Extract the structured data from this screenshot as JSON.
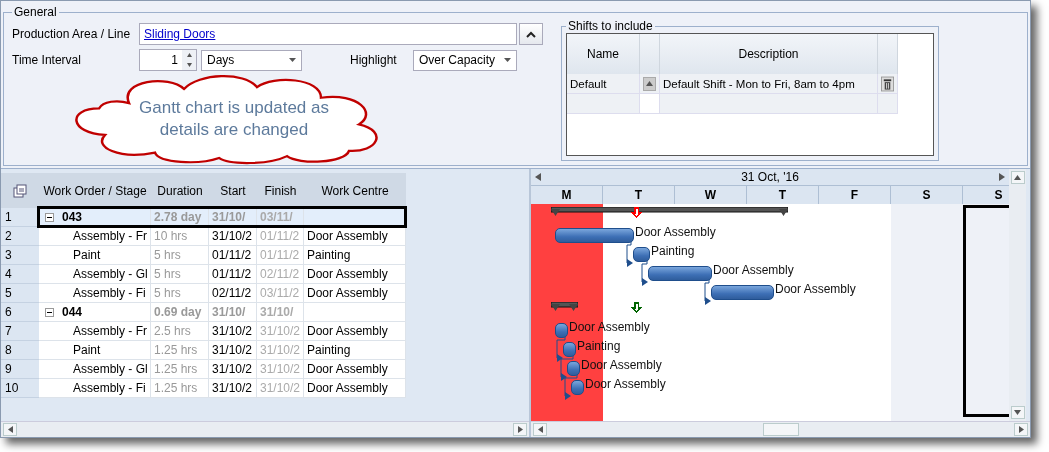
{
  "general": {
    "title": "General",
    "production_area": {
      "label": "Production Area / Line",
      "value": "Sliding Doors"
    },
    "time_interval": {
      "label": "Time Interval",
      "value": "1",
      "unit": "Days"
    },
    "highlight": {
      "label": "Highlight",
      "value": "Over Capacity"
    }
  },
  "shifts": {
    "title": "Shifts to include",
    "columns": [
      "Name",
      "Description"
    ],
    "rows": [
      {
        "name": "Default",
        "description": "Default Shift - Mon to Fri, 8am to 4pm"
      }
    ]
  },
  "callout": {
    "text": "Gantt chart is updated as details are changed"
  },
  "grid": {
    "columns": [
      "Work Order / Stage",
      "Duration",
      "Start",
      "Finish",
      "Work Centre"
    ],
    "rows": [
      {
        "number": "1",
        "name": "043",
        "duration": "2.78 day",
        "start": "31/10/",
        "finish": "03/11/",
        "expanded": true,
        "selected": true,
        "children": [
          {
            "number": "2",
            "name": "Assembly - Fr",
            "duration": "10 hrs",
            "start": "31/10/2",
            "finish": "01/11/2",
            "work_centre": "Door Assembly",
            "selected": false
          },
          {
            "number": "3",
            "name": "Paint",
            "duration": "5 hrs",
            "start": "01/11/2",
            "finish": "01/11/2",
            "work_centre": "Painting",
            "selected": false
          },
          {
            "number": "4",
            "name": "Assembly - Gl",
            "duration": "5 hrs",
            "start": "01/11/2",
            "finish": "02/11/2",
            "work_centre": "Door Assembly",
            "selected": false
          },
          {
            "number": "5",
            "name": "Assembly - Fi",
            "duration": "5 hrs",
            "start": "02/11/2",
            "finish": "03/11/2",
            "work_centre": "Door Assembly",
            "selected": false
          }
        ]
      },
      {
        "number": "6",
        "name": "044",
        "duration": "0.69 day",
        "start": "31/10/",
        "finish": "31/10/",
        "expanded": true,
        "selected": false,
        "children": [
          {
            "number": "7",
            "name": "Assembly - Fr",
            "duration": "2.5 hrs",
            "start": "31/10/2",
            "finish": "31/10/2",
            "work_centre": "Door Assembly",
            "selected": false
          },
          {
            "number": "8",
            "name": "Paint",
            "duration": "1.25 hrs",
            "start": "31/10/2",
            "finish": "31/10/2",
            "work_centre": "Painting",
            "selected": false
          },
          {
            "number": "9",
            "name": "Assembly - Gl",
            "duration": "1.25 hrs",
            "start": "31/10/2",
            "finish": "31/10/2",
            "work_centre": "Door Assembly",
            "selected": false
          },
          {
            "number": "10",
            "name": "Assembly - Fi",
            "duration": "1.25 hrs",
            "start": "31/10/2",
            "finish": "31/10/2",
            "work_centre": "Door Assembly",
            "selected": false
          }
        ]
      }
    ]
  },
  "gantt": {
    "date": "31 Oct, '16",
    "days": [
      {
        "label": "M",
        "over_capacity": true,
        "weekend": false
      },
      {
        "label": "T",
        "over_capacity": false,
        "weekend": false
      },
      {
        "label": "W",
        "over_capacity": false,
        "weekend": false
      },
      {
        "label": "T",
        "over_capacity": false,
        "weekend": false
      },
      {
        "label": "F",
        "over_capacity": false,
        "weekend": false
      },
      {
        "label": "S",
        "over_capacity": false,
        "weekend": true
      },
      {
        "label": "S",
        "over_capacity": false,
        "weekend": true
      }
    ],
    "rows": [
      {
        "kind": "summary",
        "color": "#ff0000"
      },
      {
        "kind": "task",
        "label": "Door Assembly"
      },
      {
        "kind": "task",
        "label": "Painting"
      },
      {
        "kind": "task",
        "label": "Door Assembly"
      },
      {
        "kind": "task",
        "label": "Door Assembly"
      },
      {
        "kind": "summary",
        "color": "#006400"
      },
      {
        "kind": "task",
        "label": "Door Assembly"
      },
      {
        "kind": "task",
        "label": "Painting"
      },
      {
        "kind": "task",
        "label": "Door Assembly"
      },
      {
        "kind": "task",
        "label": "Door Assembly"
      }
    ]
  }
}
